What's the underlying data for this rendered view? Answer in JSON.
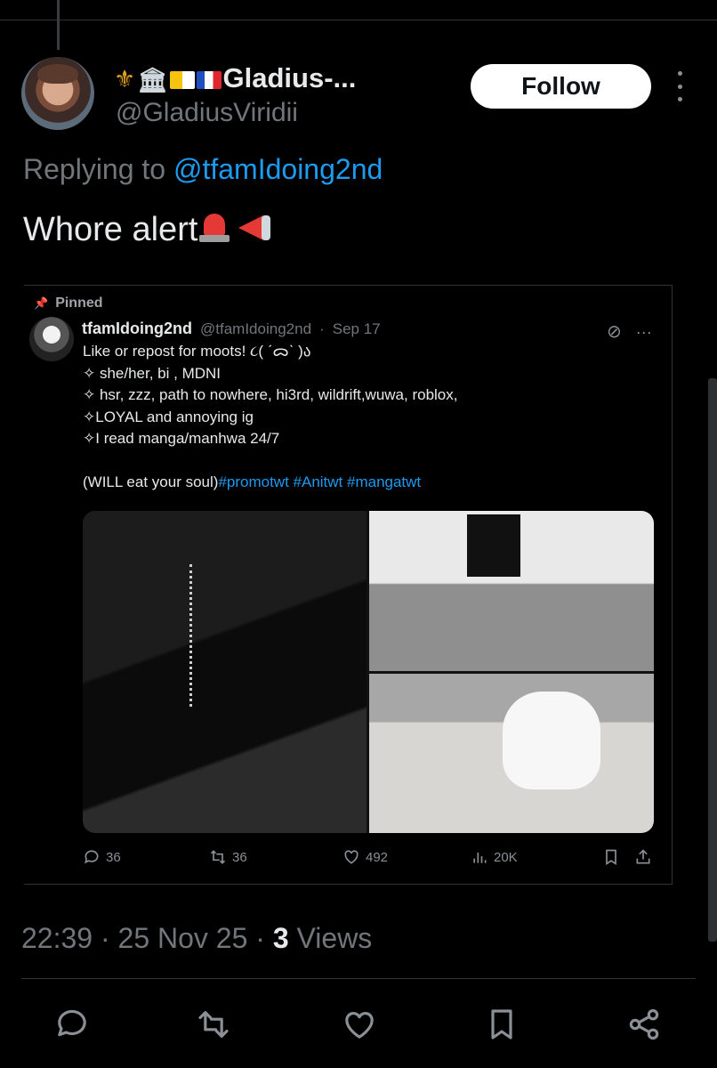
{
  "post": {
    "display_name": "Gladius-...",
    "name_emojis": [
      "fleur-de-lis-emoji",
      "classical-building-emoji",
      "vatican-flag",
      "france-flag"
    ],
    "handle": "@GladiusViridii",
    "follow_label": "Follow",
    "replying_prefix": "Replying to",
    "replying_to": "@tfamIdoing2nd",
    "text": "Whore alert",
    "text_emojis": [
      "police-light-emoji",
      "megaphone-emoji"
    ],
    "time": "22:39",
    "date": "25 Nov 25",
    "separator": "·",
    "views_count": "3",
    "views_label": "Views"
  },
  "embed": {
    "pinned_label": "Pinned",
    "name": "tfamIdoing2nd",
    "handle": "@tfamIdoing2nd",
    "date": "Sep 17",
    "bio_lines": [
      "Like or repost for moots! ૮( ˊᯅˋ )ა",
      "✧ she/her, bi , MDNI",
      "✧ hsr, zzz, path to nowhere, hi3rd, wildrift,wuwa, roblox,",
      "✧LOYAL and annoying ig",
      "✧I read manga/manhwa 24/7",
      "",
      "(WILL eat your soul)"
    ],
    "hashtags": "#promotwt #Anitwt #mangatwt",
    "stats": {
      "replies": "36",
      "reposts": "36",
      "likes": "492",
      "views": "20K"
    }
  },
  "actions": [
    "reply-icon",
    "repost-icon",
    "like-icon",
    "bookmark-icon",
    "share-icon"
  ],
  "colors": {
    "background": "#000000",
    "text": "#e7e9ea",
    "secondary": "#71767b",
    "link": "#1d9bf0"
  }
}
